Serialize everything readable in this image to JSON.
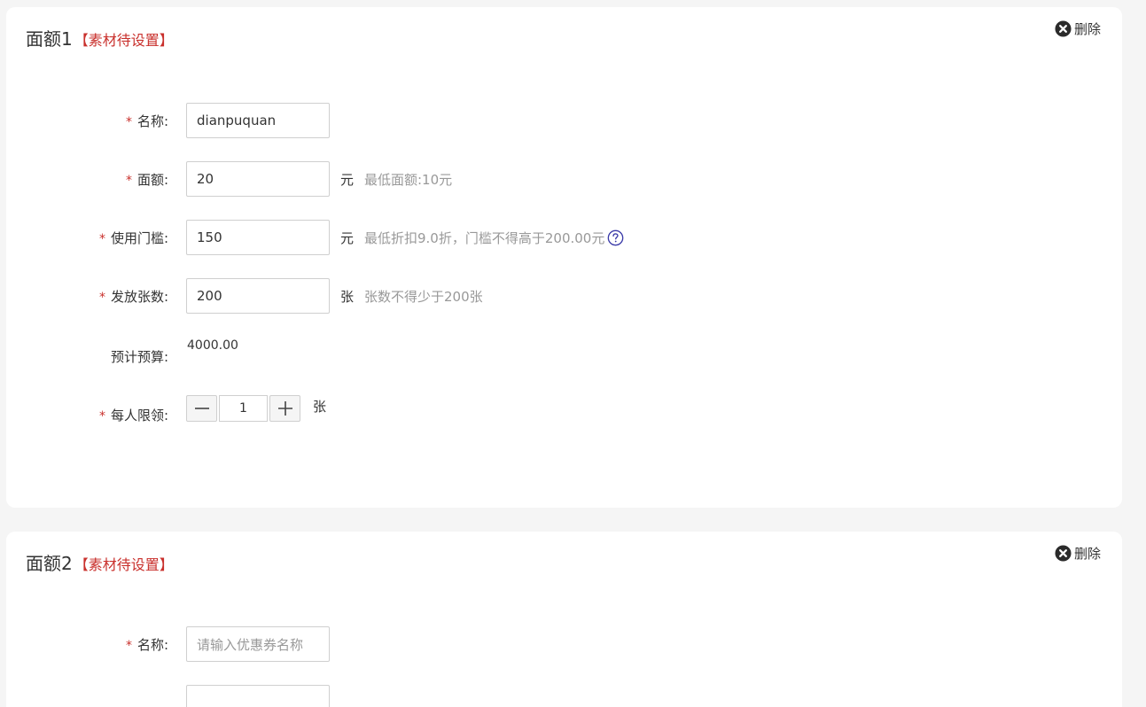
{
  "cards": [
    {
      "title": "面额1",
      "tag": "【素材待设置】",
      "delete_label": "删除",
      "fields": {
        "name": {
          "required": "*",
          "label": "名称:",
          "value": "dianpuquan"
        },
        "amount": {
          "required": "*",
          "label": "面额:",
          "value": "20",
          "unit": "元",
          "hint": "最低面额:10元"
        },
        "threshold": {
          "required": "*",
          "label": "使用门槛:",
          "value": "150",
          "unit": "元",
          "hint": "最低折扣9.0折，门槛不得高于200.00元"
        },
        "quantity": {
          "required": "*",
          "label": "发放张数:",
          "value": "200",
          "unit": "张",
          "hint": "张数不得少于200张"
        },
        "budget": {
          "label": "预计预算:",
          "value": "4000.00"
        },
        "limit": {
          "required": "*",
          "label": "每人限领:",
          "value": "1",
          "unit": "张"
        }
      }
    },
    {
      "title": "面额2",
      "tag": "【素材待设置】",
      "delete_label": "删除",
      "fields": {
        "name": {
          "required": "*",
          "label": "名称:",
          "placeholder": "请输入优惠券名称"
        }
      }
    }
  ],
  "colors": {
    "accent_red": "#c9302c",
    "hint_gray": "#999999",
    "help_icon": "#3a3aa8"
  },
  "icons": {
    "delete": "close-circle-icon",
    "help": "question-circle-icon",
    "minus": "minus-icon",
    "plus": "plus-icon"
  }
}
